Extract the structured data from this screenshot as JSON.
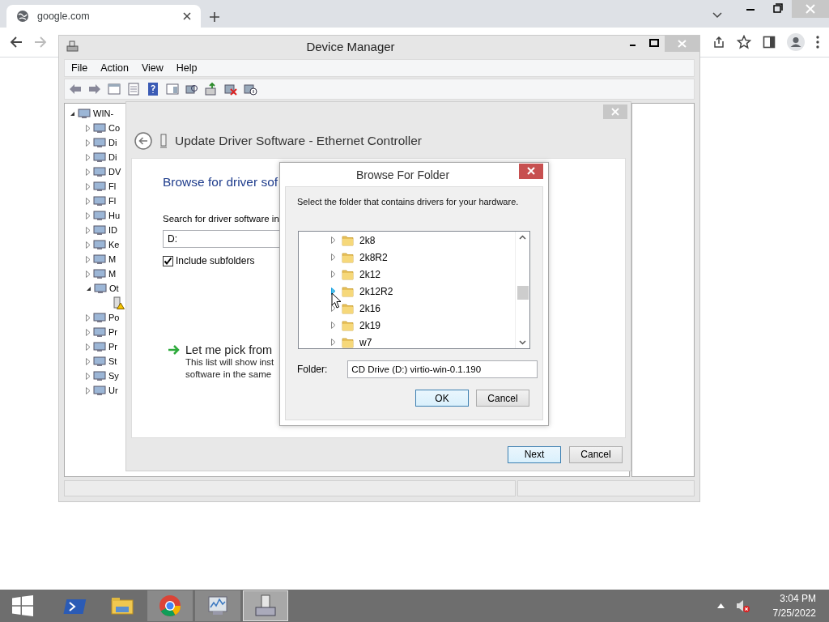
{
  "browser": {
    "tabs": [
      {
        "title": "google.com",
        "selected": true
      }
    ]
  },
  "device_manager": {
    "title": "Device Manager",
    "menu": [
      "File",
      "Action",
      "View",
      "Help"
    ],
    "tree": {
      "label": "WIN-",
      "expanded": true,
      "children": [
        {
          "label": "Co",
          "expanded": false
        },
        {
          "label": "Di",
          "expanded": false
        },
        {
          "label": "Di",
          "expanded": false
        },
        {
          "label": "DV",
          "expanded": false
        },
        {
          "label": "Fl",
          "expanded": false
        },
        {
          "label": "Fl",
          "expanded": false
        },
        {
          "label": "Hu",
          "expanded": false
        },
        {
          "label": "ID",
          "expanded": false
        },
        {
          "label": "Ke",
          "expanded": false
        },
        {
          "label": "M",
          "expanded": false
        },
        {
          "label": "M",
          "expanded": false
        },
        {
          "label": "Ot",
          "expanded": true,
          "children": [
            {
              "kind": "warning-device"
            }
          ]
        },
        {
          "label": "Po",
          "expanded": false
        },
        {
          "label": "Pr",
          "expanded": false
        },
        {
          "label": "Pr",
          "expanded": false
        },
        {
          "label": "St",
          "expanded": false
        },
        {
          "label": "Sy",
          "expanded": false
        },
        {
          "label": "Ur",
          "expanded": false
        }
      ]
    }
  },
  "update_driver": {
    "title": "Update Driver Software - Ethernet Controller",
    "heading": "Browse for driver sof",
    "search_label": "Search for driver software in",
    "path": "D:",
    "include_subfolders": {
      "label": "Include subfolders",
      "checked": true
    },
    "pick": {
      "title": "Let me pick from",
      "description": [
        "This list will show inst",
        "software in the same"
      ]
    },
    "buttons": [
      {
        "label": "Next",
        "default": true
      },
      {
        "label": "Cancel",
        "default": false
      }
    ]
  },
  "browse_folder": {
    "title": "Browse For Folder",
    "instruction": "Select the folder that contains drivers for your hardware.",
    "folders": [
      {
        "name": "2k8",
        "expanded": false,
        "hover": false
      },
      {
        "name": "2k8R2",
        "expanded": false,
        "hover": false
      },
      {
        "name": "2k12",
        "expanded": false,
        "hover": false
      },
      {
        "name": "2k12R2",
        "expanded": false,
        "hover": true
      },
      {
        "name": "2k16",
        "expanded": false,
        "hover": false
      },
      {
        "name": "2k19",
        "expanded": false,
        "hover": false
      },
      {
        "name": "w7",
        "expanded": false,
        "hover": false
      }
    ],
    "folder_label": "Folder:",
    "folder_value": "CD Drive (D:) virtio-win-0.1.190",
    "buttons": [
      {
        "label": "OK",
        "default": true
      },
      {
        "label": "Cancel",
        "default": false
      }
    ]
  },
  "taskbar": {
    "apps": [
      {
        "kind": "powershell",
        "running": false,
        "focused": false
      },
      {
        "kind": "explorer",
        "running": false,
        "focused": false
      },
      {
        "kind": "chrome",
        "running": true,
        "focused": false
      },
      {
        "kind": "monitor",
        "running": true,
        "focused": false
      },
      {
        "kind": "device-manager",
        "running": true,
        "focused": true
      }
    ],
    "time": "3:04 PM",
    "date": "7/25/2022"
  }
}
